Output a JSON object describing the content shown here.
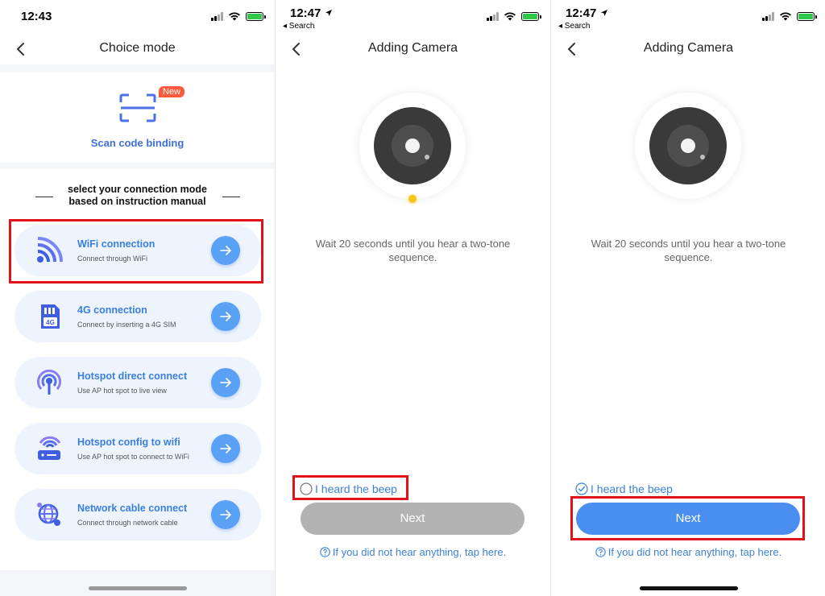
{
  "panel1": {
    "status": {
      "time": "12:43"
    },
    "nav": {
      "title": "Choice mode"
    },
    "scan": {
      "badge": "New",
      "label": "Scan code binding"
    },
    "instruction": {
      "line1": "select your connection mode",
      "line2": "based on instruction manual"
    },
    "modes": [
      {
        "icon": "wifi-icon",
        "title": "WiFi connection",
        "subtitle": "Connect through WiFi"
      },
      {
        "icon": "sim-card-icon",
        "title": "4G connection",
        "subtitle": "Connect by inserting a 4G SIM"
      },
      {
        "icon": "hotspot-icon",
        "title": "Hotspot direct connect",
        "subtitle": "Use AP hot spot to live view"
      },
      {
        "icon": "router-icon",
        "title": "Hotspot config to wifi",
        "subtitle": "Use AP hot spot to connect to WiFi"
      },
      {
        "icon": "network-globe-icon",
        "title": "Network cable connect",
        "subtitle": "Connect through network cable"
      }
    ],
    "sim_label": "4G"
  },
  "panel2": {
    "status": {
      "time": "12:47",
      "back_link": "◂ Search"
    },
    "nav": {
      "title": "Adding Camera"
    },
    "wait_text": "Wait 20 seconds until you hear a two-tone sequence.",
    "heard_label": "I heard the beep",
    "heard_checked": false,
    "next_label": "Next",
    "help_text": "If you did not hear anything, tap here."
  },
  "panel3": {
    "status": {
      "time": "12:47",
      "back_link": "◂ Search"
    },
    "nav": {
      "title": "Adding Camera"
    },
    "wait_text": "Wait 20 seconds until you hear a two-tone sequence.",
    "heard_label": "I heard the beep",
    "heard_checked": true,
    "next_label": "Next",
    "help_text": "If you did not hear anything, tap here."
  },
  "colors": {
    "accent": "#3e82d8",
    "card_bg": "#eef4fd",
    "highlight": "#e0131b",
    "badge": "#ff5a3c",
    "led": "#f8c417",
    "button_disabled": "#b3b3b3",
    "button_active": "#4a8ff0"
  }
}
